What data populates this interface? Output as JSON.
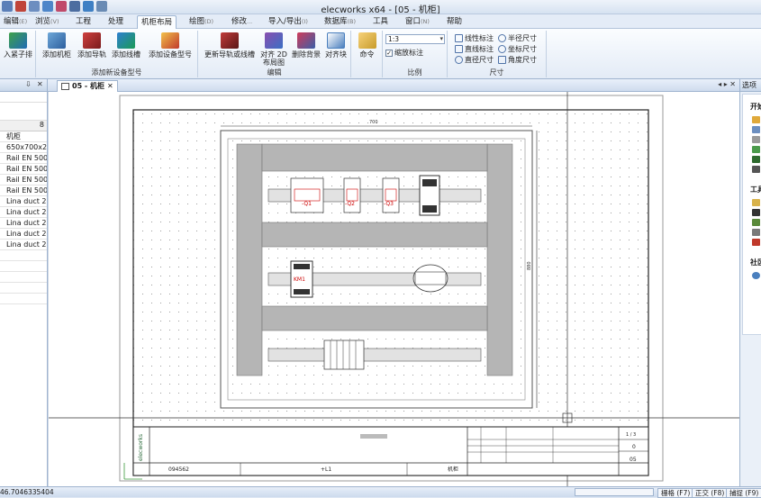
{
  "app": {
    "title": "elecworks x64 - [05 - 机柜]"
  },
  "menu": {
    "tabs": [
      {
        "label": "编辑",
        "key": "(E)",
        "active": false
      },
      {
        "label": "浏览",
        "key": "(V)",
        "active": false
      },
      {
        "label": "工程",
        "key": "",
        "active": false
      },
      {
        "label": "处理",
        "key": "",
        "active": false
      },
      {
        "label": "机柜布局",
        "key": "",
        "active": true
      },
      {
        "label": "绘图",
        "key": "(D)",
        "active": false
      },
      {
        "label": "修改",
        "key": "...",
        "active": false
      },
      {
        "label": "导入/导出",
        "key": "(I)",
        "active": false
      },
      {
        "label": "数据库",
        "key": "(B)",
        "active": false
      },
      {
        "label": "工具",
        "key": "",
        "active": false
      },
      {
        "label": "窗口",
        "key": "(N)",
        "active": false
      },
      {
        "label": "帮助",
        "key": "",
        "active": false
      }
    ]
  },
  "ribbon": {
    "insert_row_label": "入紧子排",
    "add_cabinet": "添加机柜",
    "add_rail": "添加导轨",
    "add_duct": "添加线槽",
    "add_device": "添加设备型号",
    "group_add_new": "添加新设备型号",
    "update_rails": "更新导轨或线槽",
    "align_2d": "对齐 2D 布局图",
    "delete_bg": "删除背景",
    "align_block": "对齐块",
    "group_edit": "编辑",
    "command": "命令",
    "scale_value": "1:3",
    "scale_checkbox": "缩放标注",
    "group_scale": "比例",
    "dim_linear": "线性标注",
    "dim_aligned": "直线标注",
    "dim_radius": "半径尺寸",
    "dim_diameter": "直径尺寸",
    "dim_angle": "角度尺寸",
    "dim_coord": "坐标尺寸",
    "group_dim": "尺寸"
  },
  "left_panel": {
    "header_pin": "⇩",
    "header_close": "✕",
    "col_count": "8",
    "items": [
      "机柜",
      "650x700x2",
      "Rail EN 500",
      "Rail EN 500",
      "Rail EN 500",
      "Rail EN 500",
      "Lina duct 2",
      "Lina duct 2",
      "Lina duct 2",
      "Lina duct 2",
      "Lina duct 2"
    ]
  },
  "doc_tab": {
    "label": "05 - 机柜",
    "close": "✕",
    "nav": "◂ ▸ ✕"
  },
  "drawing": {
    "dim_top": "700",
    "dim_right": "880",
    "labels": {
      "d1": "-Q1",
      "d2": "-Q2",
      "d3": "-Q3",
      "km1": "KM1",
      "blurred": "..."
    },
    "title_block": {
      "brand": "elecworks",
      "left_code": "094562",
      "center_code": "+L1",
      "sheet_name": "机柜",
      "page_fraction": "1 / 3",
      "rev": "0",
      "page_no": "05"
    }
  },
  "right_panel": {
    "header": "选项",
    "section1": "开始",
    "section2": "工具",
    "section3": "社区"
  },
  "status": {
    "coords": "46.7046335404",
    "ortho_grid": "栅格 (F7)",
    "ortho": "正交 (F8)",
    "snap": "捕捉 (F9)"
  },
  "colors": {
    "accent": "#c8d7ea",
    "duct_gray": "#b5b5b5",
    "rail_gray": "#e2e2e2",
    "label_red": "#cc0000"
  }
}
